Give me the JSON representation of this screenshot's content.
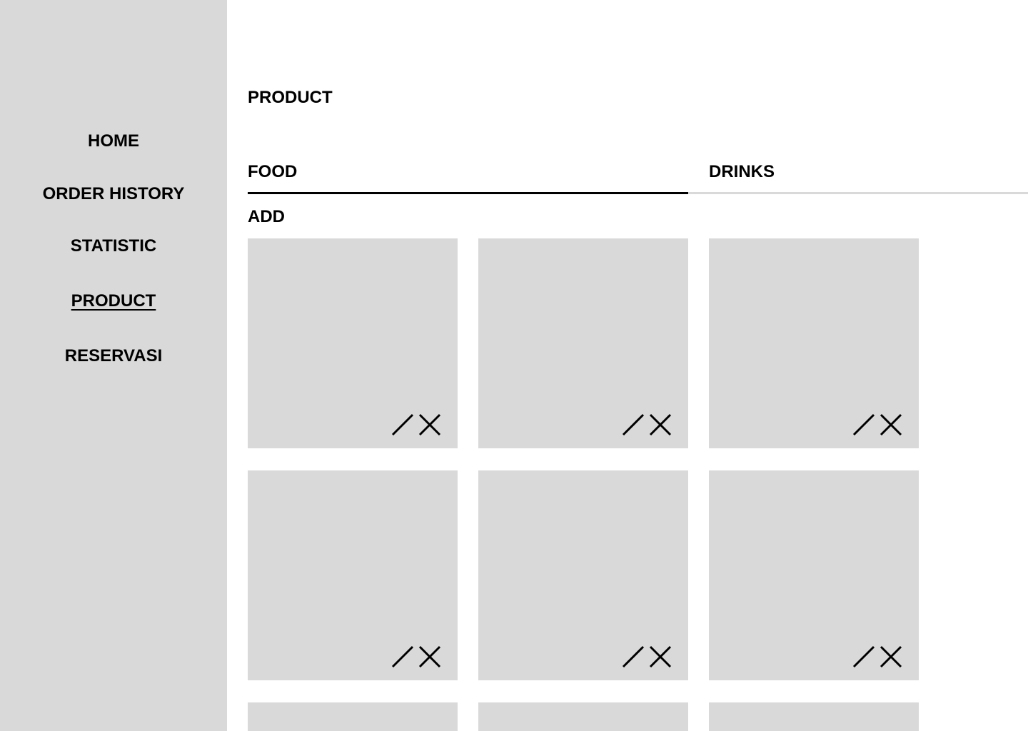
{
  "sidebar": {
    "items": [
      {
        "label": "HOME",
        "active": false
      },
      {
        "label": "ORDER HISTORY",
        "active": false
      },
      {
        "label": "STATISTIC",
        "active": false
      },
      {
        "label": "PRODUCT",
        "active": true
      },
      {
        "label": "RESERVASI",
        "active": false
      }
    ]
  },
  "main": {
    "title": "PRODUCT",
    "tabs": [
      {
        "label": "FOOD",
        "active": true
      },
      {
        "label": "DRINKS",
        "active": false
      }
    ],
    "add_label": "ADD",
    "card_actions": [
      {
        "icon": "edit-icon"
      },
      {
        "icon": "delete-icon"
      }
    ]
  },
  "colors": {
    "sidebar_bg": "#d9d9d9",
    "card_bg": "#d9d9d9",
    "text": "#000000",
    "active_tab_line": "#000000",
    "inactive_tab_line": "#d9d9d9"
  }
}
